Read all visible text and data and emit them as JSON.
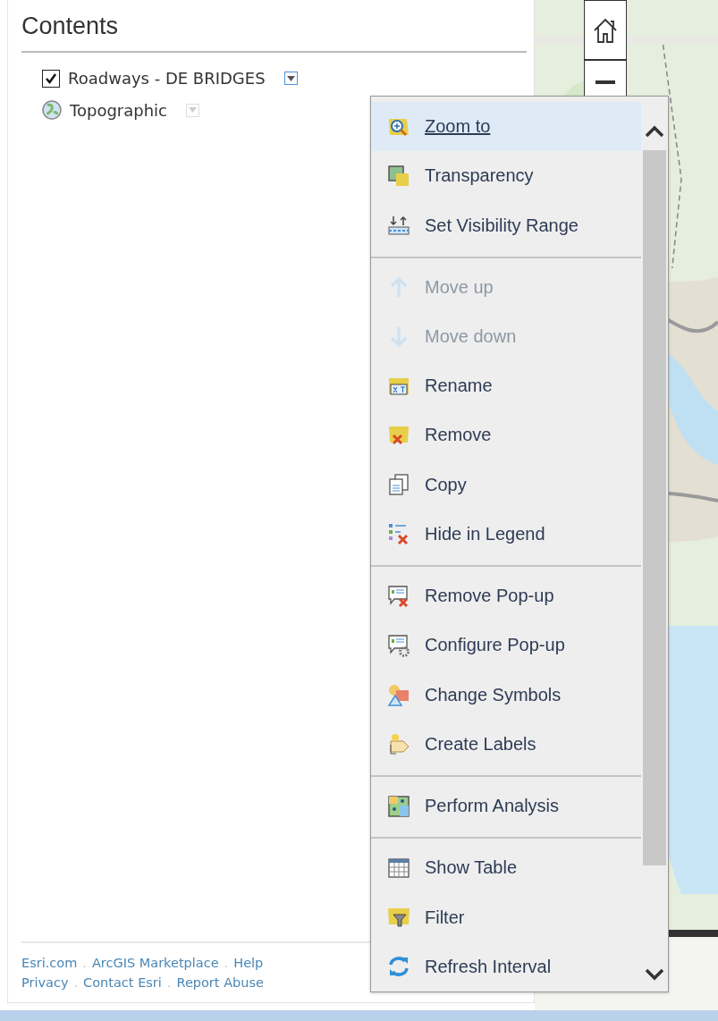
{
  "contents": {
    "title": "Contents",
    "layers": [
      {
        "kind": "checkbox",
        "name": "Roadways - DE BRIDGES",
        "checked": true,
        "expanded": true
      },
      {
        "kind": "basemap",
        "name": "Topographic",
        "expanded": false
      }
    ]
  },
  "menu": {
    "groups": [
      [
        {
          "label": "Zoom to",
          "selected": true,
          "disabled": false
        },
        {
          "label": "Transparency",
          "selected": false,
          "disabled": false
        },
        {
          "label": "Set Visibility Range",
          "selected": false,
          "disabled": false
        }
      ],
      [
        {
          "label": "Move up",
          "selected": false,
          "disabled": true
        },
        {
          "label": "Move down",
          "selected": false,
          "disabled": true
        },
        {
          "label": "Rename",
          "selected": false,
          "disabled": false
        },
        {
          "label": "Remove",
          "selected": false,
          "disabled": false
        },
        {
          "label": "Copy",
          "selected": false,
          "disabled": false
        },
        {
          "label": "Hide in Legend",
          "selected": false,
          "disabled": false
        }
      ],
      [
        {
          "label": "Remove Pop-up",
          "selected": false,
          "disabled": false
        },
        {
          "label": "Configure Pop-up",
          "selected": false,
          "disabled": false
        },
        {
          "label": "Change Symbols",
          "selected": false,
          "disabled": false
        },
        {
          "label": "Create Labels",
          "selected": false,
          "disabled": false
        }
      ],
      [
        {
          "label": "Perform Analysis",
          "selected": false,
          "disabled": false
        }
      ],
      [
        {
          "label": "Show Table",
          "selected": false,
          "disabled": false
        },
        {
          "label": "Filter",
          "selected": false,
          "disabled": false
        },
        {
          "label": "Refresh Interval",
          "selected": false,
          "disabled": false
        }
      ]
    ]
  },
  "footer": {
    "separator": ".",
    "lines": [
      [
        "Esri.com",
        "ArcGIS Marketplace",
        "Help"
      ],
      [
        "Privacy",
        "Contact Esri",
        "Report Abuse"
      ]
    ]
  }
}
